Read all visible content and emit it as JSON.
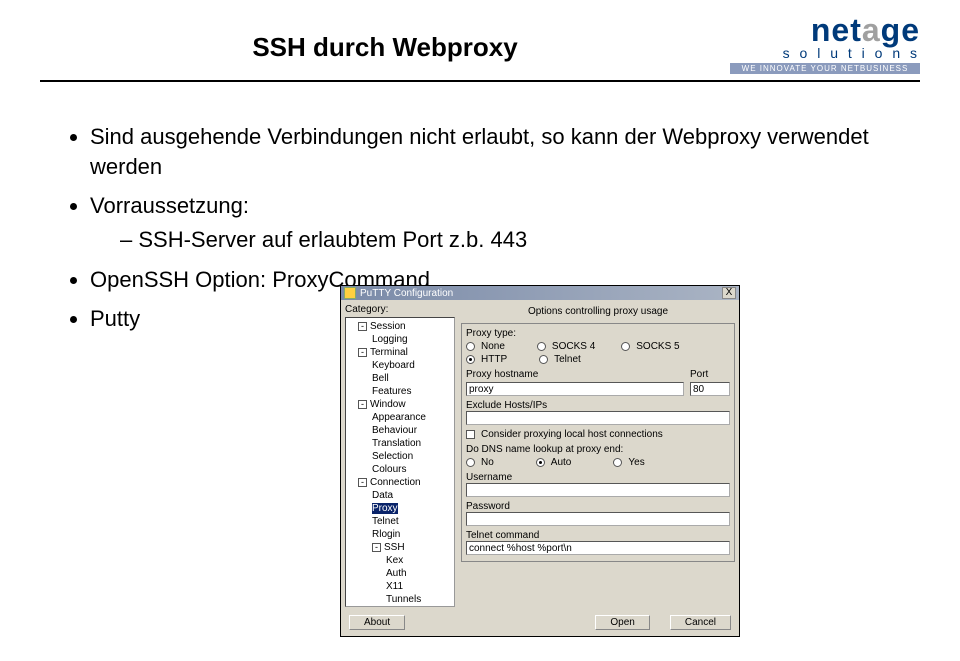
{
  "header": {
    "title": "SSH durch Webproxy",
    "logo": {
      "brand1": "net",
      "brand2": "a",
      "brand3": "ge",
      "sub": "s o l u t i o n s",
      "tagline": "WE INNOVATE YOUR NETBUSINESS"
    }
  },
  "bullets": {
    "b1": "Sind ausgehende Verbindungen nicht erlaubt, so kann der Webproxy verwendet werden",
    "b2": "Vorraussetzung:",
    "b2a": "SSH-Server auf erlaubtem Port z.b. 443",
    "b3": "OpenSSH Option: ProxyCommand",
    "b4": "Putty"
  },
  "putty": {
    "title": "PuTTY Configuration",
    "close": "X",
    "category_label": "Category:",
    "tree": {
      "session": "Session",
      "logging": "Logging",
      "terminal": "Terminal",
      "keyboard": "Keyboard",
      "bell": "Bell",
      "features": "Features",
      "window": "Window",
      "appearance": "Appearance",
      "behaviour": "Behaviour",
      "translation": "Translation",
      "selection": "Selection",
      "colours": "Colours",
      "connection": "Connection",
      "data": "Data",
      "proxy": "Proxy",
      "telnet": "Telnet",
      "rlogin": "Rlogin",
      "ssh": "SSH",
      "kex": "Kex",
      "auth": "Auth",
      "x11": "X11",
      "tunnels": "Tunnels"
    },
    "panel": {
      "heading": "Options controlling proxy usage",
      "proxy_type_label": "Proxy type:",
      "type_none": "None",
      "type_socks4": "SOCKS 4",
      "type_socks5": "SOCKS 5",
      "type_http": "HTTP",
      "type_telnet": "Telnet",
      "hostname_label": "Proxy hostname",
      "port_label": "Port",
      "hostname_value": "proxy",
      "port_value": "80",
      "exclude_label": "Exclude Hosts/IPs",
      "exclude_value": "",
      "consider_label": "Consider proxying local host connections",
      "dns_label": "Do DNS name lookup at proxy end:",
      "dns_no": "No",
      "dns_auto": "Auto",
      "dns_yes": "Yes",
      "username_label": "Username",
      "username_value": "",
      "password_label": "Password",
      "password_value": "",
      "telnet_cmd_label": "Telnet command",
      "telnet_cmd_value": "connect %host %port\\n"
    },
    "buttons": {
      "about": "About",
      "open": "Open",
      "cancel": "Cancel"
    }
  }
}
